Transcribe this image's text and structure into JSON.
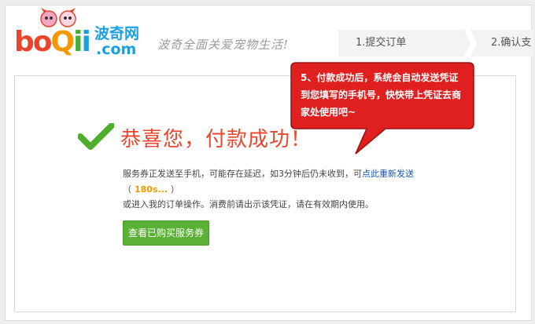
{
  "logo": {
    "brand": "boqii",
    "brand_parts": [
      "bo",
      "Q",
      "i",
      "i"
    ],
    "cn_name": "波奇网",
    "domain": ".com"
  },
  "slogan": "波奇全面关爱宠物生活!",
  "steps": [
    {
      "label": "1.提交订单"
    },
    {
      "label": "2.确认支"
    }
  ],
  "success": {
    "title": "恭喜您，付款成功！",
    "line1_text": "服务券正发送至手机，可能存在延迟，如3分钟后仍未收到，可",
    "line1_link": "点此重新发送",
    "countdown_open": "（",
    "countdown": "180s...",
    "countdown_close": "）",
    "line3_text": "或进入我的订单操作。消费前请出示该凭证，请在有效期内使用。",
    "button_label": "查看已购买服务券"
  },
  "callout": {
    "text": "5、付款成功后，系统会自动发送凭证到您填写的手机号，快快带上凭证去商家处使用吧~"
  },
  "colors": {
    "accent_red": "#e8452c",
    "button_green": "#5bb036",
    "link_blue": "#1456b8",
    "countdown_orange": "#f39800",
    "callout_red": "#e01f1f"
  }
}
